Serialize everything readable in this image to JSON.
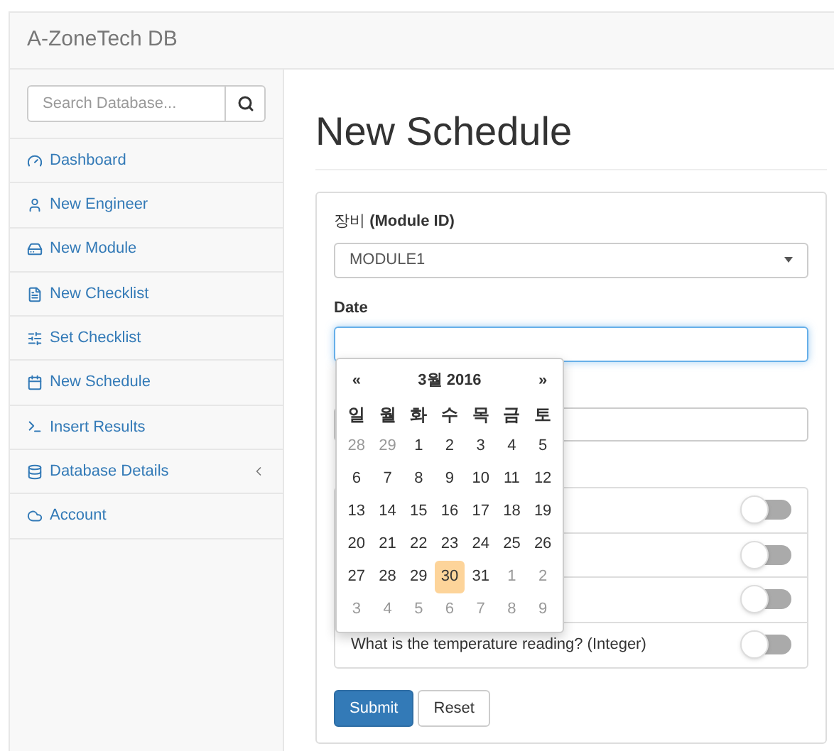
{
  "navbar": {
    "brand": "A-ZoneTech DB"
  },
  "sidebar": {
    "search": {
      "placeholder": "Search Database..."
    },
    "items": [
      {
        "label": "Dashboard",
        "expandable": false
      },
      {
        "label": "New Engineer",
        "expandable": false
      },
      {
        "label": "New Module",
        "expandable": false
      },
      {
        "label": "New Checklist",
        "expandable": false
      },
      {
        "label": "Set Checklist",
        "expandable": false
      },
      {
        "label": "New Schedule",
        "expandable": false
      },
      {
        "label": "Insert Results",
        "expandable": false
      },
      {
        "label": "Database Details",
        "expandable": true
      },
      {
        "label": "Account",
        "expandable": false
      }
    ]
  },
  "page": {
    "title": "New Schedule"
  },
  "form": {
    "module_label": "장비 **(Module ID)**",
    "module_value": "MODULE1",
    "date_label": "Date",
    "checks": [
      {
        "on": false
      },
      {
        "on": false
      },
      {
        "on": false
      },
      {
        "label": "What is the temperature reading? (Integer)",
        "on": false
      }
    ],
    "buttons": [
      {
        "label": "Submit",
        "kind": "primary"
      },
      {
        "label": "Reset",
        "kind": "default"
      }
    ]
  },
  "datepicker": {
    "prev": "«",
    "title": "3월 2016",
    "next": "»",
    "weekdays": [
      "일",
      "월",
      "화",
      "수",
      "목",
      "금",
      "토"
    ],
    "days": [
      {
        "day": "28",
        "muted": true,
        "selected": false
      },
      {
        "day": "29",
        "muted": true,
        "selected": false
      },
      {
        "day": "1",
        "muted": false,
        "selected": false
      },
      {
        "day": "2",
        "muted": false,
        "selected": false
      },
      {
        "day": "3",
        "muted": false,
        "selected": false
      },
      {
        "day": "4",
        "muted": false,
        "selected": false
      },
      {
        "day": "5",
        "muted": false,
        "selected": false
      },
      {
        "day": "6",
        "muted": false,
        "selected": false
      },
      {
        "day": "7",
        "muted": false,
        "selected": false
      },
      {
        "day": "8",
        "muted": false,
        "selected": false
      },
      {
        "day": "9",
        "muted": false,
        "selected": false
      },
      {
        "day": "10",
        "muted": false,
        "selected": false
      },
      {
        "day": "11",
        "muted": false,
        "selected": false
      },
      {
        "day": "12",
        "muted": false,
        "selected": false
      },
      {
        "day": "13",
        "muted": false,
        "selected": false
      },
      {
        "day": "14",
        "muted": false,
        "selected": false
      },
      {
        "day": "15",
        "muted": false,
        "selected": false
      },
      {
        "day": "16",
        "muted": false,
        "selected": false
      },
      {
        "day": "17",
        "muted": false,
        "selected": false
      },
      {
        "day": "18",
        "muted": false,
        "selected": false
      },
      {
        "day": "19",
        "muted": false,
        "selected": false
      },
      {
        "day": "20",
        "muted": false,
        "selected": false
      },
      {
        "day": "21",
        "muted": false,
        "selected": false
      },
      {
        "day": "22",
        "muted": false,
        "selected": false
      },
      {
        "day": "23",
        "muted": false,
        "selected": false
      },
      {
        "day": "24",
        "muted": false,
        "selected": false
      },
      {
        "day": "25",
        "muted": false,
        "selected": false
      },
      {
        "day": "26",
        "muted": false,
        "selected": false
      },
      {
        "day": "27",
        "muted": false,
        "selected": false
      },
      {
        "day": "28",
        "muted": false,
        "selected": false
      },
      {
        "day": "29",
        "muted": false,
        "selected": false
      },
      {
        "day": "30",
        "muted": false,
        "selected": true
      },
      {
        "day": "31",
        "muted": false,
        "selected": false
      },
      {
        "day": "1",
        "muted": true,
        "selected": false
      },
      {
        "day": "2",
        "muted": true,
        "selected": false
      },
      {
        "day": "3",
        "muted": true,
        "selected": false
      },
      {
        "day": "4",
        "muted": true,
        "selected": false
      },
      {
        "day": "5",
        "muted": true,
        "selected": false
      },
      {
        "day": "6",
        "muted": true,
        "selected": false
      },
      {
        "day": "7",
        "muted": true,
        "selected": false
      },
      {
        "day": "8",
        "muted": true,
        "selected": false
      },
      {
        "day": "9",
        "muted": true,
        "selected": false
      }
    ]
  }
}
